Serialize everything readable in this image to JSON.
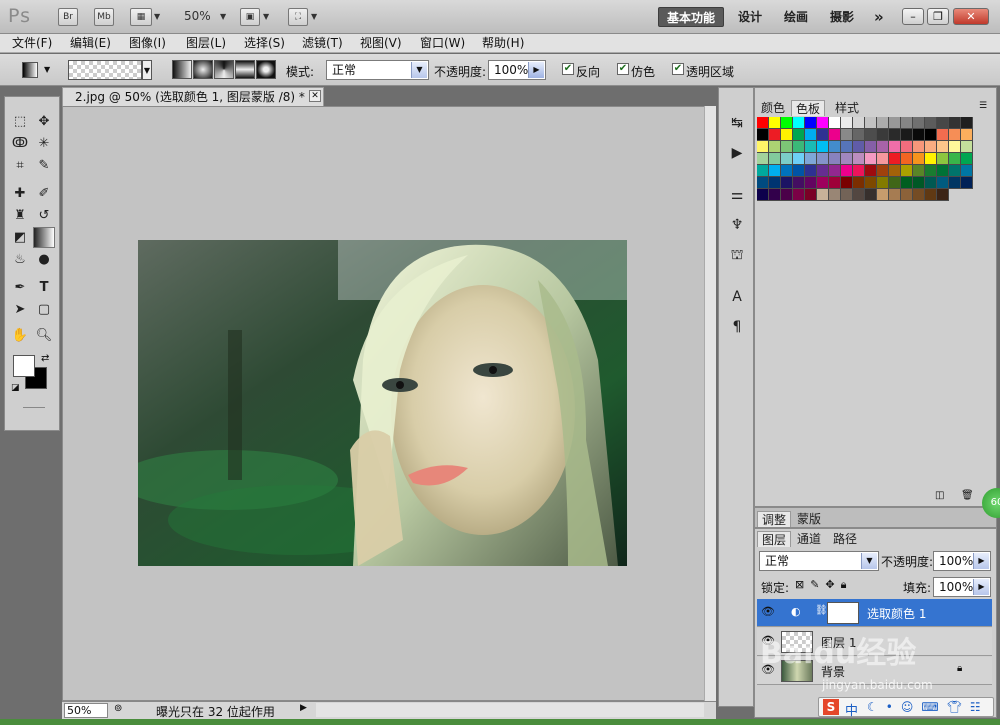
{
  "app": {
    "logo": "Ps"
  },
  "titlebar": {
    "bridge_label": "Br",
    "minibridge_label": "Mb",
    "zoom": "50%",
    "workspaces": [
      "基本功能",
      "设计",
      "绘画",
      "摄影"
    ],
    "more": "»"
  },
  "menu": [
    "文件(F)",
    "编辑(E)",
    "图像(I)",
    "图层(L)",
    "选择(S)",
    "滤镜(T)",
    "视图(V)",
    "窗口(W)",
    "帮助(H)"
  ],
  "options": {
    "mode_label": "模式:",
    "mode_value": "正常",
    "opacity_label": "不透明度:",
    "opacity_value": "100%",
    "reverse_label": "反向",
    "dither_label": "仿色",
    "transparency_label": "透明区域"
  },
  "document": {
    "tab_title": "2.jpg @ 50% (选取颜色 1, 图层蒙版 /8) *",
    "status_zoom": "50%",
    "status_message": "曝光只在 32 位起作用"
  },
  "color_panel": {
    "tabs": [
      "颜色",
      "色板",
      "样式"
    ],
    "active_tab": 1
  },
  "swatch_colors": [
    "#ff0000",
    "#ffff00",
    "#00ff00",
    "#00ffff",
    "#0000ff",
    "#ff00ff",
    "#ffffff",
    "#ebebeb",
    "#d6d6d6",
    "#c2c2c2",
    "#adadad",
    "#999999",
    "#858585",
    "#707070",
    "#5c5c5c",
    "#474747",
    "#333333",
    "#1f1f1f",
    "#000000",
    "#ed1c24",
    "#fff200",
    "#00a651",
    "#00aeef",
    "#2e3192",
    "#ec008c",
    "#898989",
    "#666666",
    "#4d4d4d",
    "#3a3a3a",
    "#2a2a2a",
    "#1a1a1a",
    "#0a0a0a",
    "#000000",
    "#f26c4f",
    "#f68e56",
    "#fbaf5d",
    "#fff568",
    "#acd373",
    "#7cc576",
    "#3bb878",
    "#1abbb4",
    "#00bff3",
    "#438ccb",
    "#5674b9",
    "#605ca8",
    "#855fa8",
    "#a763a8",
    "#f06ea9",
    "#f26d7d",
    "#f7977a",
    "#f9ad81",
    "#fdc68a",
    "#fff79a",
    "#c4df9b",
    "#a3d39c",
    "#82ca9d",
    "#7bcdc8",
    "#6ecff6",
    "#7ea7d8",
    "#8493ca",
    "#8882be",
    "#a187be",
    "#bc8dbf",
    "#f49ac2",
    "#f5989d",
    "#ed1c24",
    "#f26522",
    "#f7941d",
    "#fff200",
    "#8dc63f",
    "#39b54a",
    "#00a651",
    "#00a99d",
    "#00aeef",
    "#0072bc",
    "#0054a6",
    "#2e3192",
    "#662d91",
    "#92278f",
    "#ec008c",
    "#ed145b",
    "#9e0b0f",
    "#a0410d",
    "#a36209",
    "#aba000",
    "#598527",
    "#1a7b30",
    "#007236",
    "#00746b",
    "#0076a3",
    "#004b80",
    "#003471",
    "#1b1464",
    "#440e62",
    "#630460",
    "#9e005d",
    "#9e0039",
    "#790000",
    "#7b2e00",
    "#7d4900",
    "#827b00",
    "#406618",
    "#005e20",
    "#005826",
    "#005952",
    "#005b7f",
    "#003663",
    "#002157",
    "#0d004c",
    "#32004b",
    "#4b0049",
    "#7b0046",
    "#7a0026",
    "#c7b299",
    "#998675",
    "#736357",
    "#534741",
    "#37302d",
    "#c69c6d",
    "#a67c52",
    "#8c6239",
    "#754c24",
    "#603913",
    "#3c2415"
  ],
  "adjust_panel": {
    "tabs": [
      "调整",
      "蒙版"
    ]
  },
  "layers_panel": {
    "tabs": [
      "图层",
      "通道",
      "路径"
    ],
    "blend_mode": "正常",
    "opacity_label": "不透明度:",
    "opacity_value": "100%",
    "lock_label": "锁定:",
    "fill_label": "填充:",
    "fill_value": "100%",
    "layers": [
      {
        "name": "选取颜色 1",
        "selected": true
      },
      {
        "name": "图层 1",
        "selected": false
      },
      {
        "name": "背景",
        "selected": false
      }
    ]
  },
  "watermark": {
    "text": "Baidu经验",
    "url": "jingyan.baidu.com"
  },
  "ime": {
    "mode": "中"
  },
  "badge": {
    "value": "60"
  }
}
